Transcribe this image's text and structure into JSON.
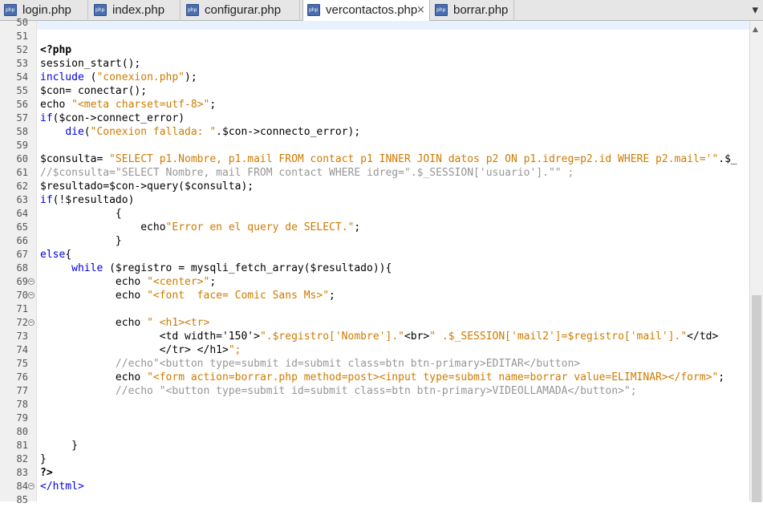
{
  "tabs": [
    {
      "label": "login.php",
      "active": false
    },
    {
      "label": "index.php",
      "active": false
    },
    {
      "label": "configurar.php",
      "active": false
    },
    {
      "label": "vercontactos.php",
      "active": true
    },
    {
      "label": "borrar.php",
      "active": false
    }
  ],
  "tab_close_glyph": "×",
  "tab_menu_glyph": "▾",
  "editor": {
    "lines": [
      {
        "n": "50",
        "t": ""
      },
      {
        "n": "51",
        "t": ""
      },
      {
        "n": "52",
        "t": "<?php"
      },
      {
        "n": "53",
        "t": "session_start();"
      },
      {
        "n": "54",
        "t": "include (\"conexion.php\");"
      },
      {
        "n": "55",
        "t": "$con= conectar();"
      },
      {
        "n": "56",
        "t": "echo \"<meta charset=utf-8>\";"
      },
      {
        "n": "57",
        "t": "if($con->connect_error)"
      },
      {
        "n": "58",
        "t": "    die(\"Conexion fallada: \".$con->connecto_error);"
      },
      {
        "n": "59",
        "t": ""
      },
      {
        "n": "60",
        "t": "$consulta= \"SELECT p1.Nombre, p1.mail FROM contact p1 INNER JOIN datos p2 ON p1.idreg=p2.id WHERE p2.mail='\".$_"
      },
      {
        "n": "61",
        "t": "//$consulta=\"SELECT Nombre, mail FROM contact WHERE idreg=\".$_SESSION['usuario'].\"\" ;"
      },
      {
        "n": "62",
        "t": "$resultado=$con->query($consulta);"
      },
      {
        "n": "63",
        "t": "if(!$resultado)"
      },
      {
        "n": "64",
        "t": "            {"
      },
      {
        "n": "65",
        "t": "                echo\"Error en el query de SELECT.\";"
      },
      {
        "n": "66",
        "t": "            }"
      },
      {
        "n": "67",
        "t": "else{"
      },
      {
        "n": "68",
        "t": "     while ($registro = mysqli_fetch_array($resultado)){"
      },
      {
        "n": "69",
        "t": "            echo \"<center>\";"
      },
      {
        "n": "70",
        "t": "            echo \"<font  face= Comic Sans Ms>\";"
      },
      {
        "n": "71",
        "t": ""
      },
      {
        "n": "72",
        "t": "            echo \" <h1><tr>"
      },
      {
        "n": "73",
        "t": "                   <td width='150'>\".$registro['Nombre'].\"<br>\" .$_SESSION['mail2']=$registro['mail'].\"</td>"
      },
      {
        "n": "74",
        "t": "                   </tr> </h1>\";"
      },
      {
        "n": "75",
        "t": "            //echo\"<button type=submit id=submit class=btn btn-primary>EDITAR</button>"
      },
      {
        "n": "76",
        "t": "            echo \"<form action=borrar.php method=post><input type=submit name=borrar value=ELIMINAR></form>\";"
      },
      {
        "n": "77",
        "t": "            //echo \"<button type=submit id=submit class=btn btn-primary>VIDEOLLAMADA</button>\";"
      },
      {
        "n": "78",
        "t": ""
      },
      {
        "n": "79",
        "t": ""
      },
      {
        "n": "80",
        "t": ""
      },
      {
        "n": "81",
        "t": "     }"
      },
      {
        "n": "82",
        "t": "}"
      },
      {
        "n": "83",
        "t": "?>"
      },
      {
        "n": "84",
        "t": "</html>"
      },
      {
        "n": "85",
        "t": ""
      }
    ]
  }
}
